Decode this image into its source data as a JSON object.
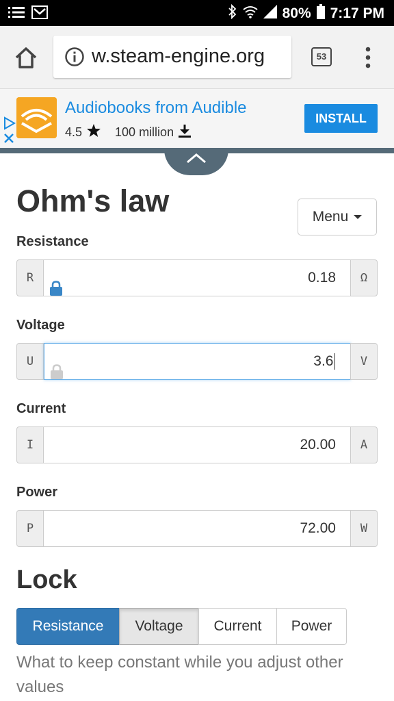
{
  "status_bar": {
    "battery": "80%",
    "time": "7:17 PM"
  },
  "browser": {
    "url": "w.steam-engine.org",
    "tab_count": "53"
  },
  "ad": {
    "title": "Audiobooks from Audible",
    "rating": "4.5",
    "downloads": "100 million",
    "install_label": "INSTALL"
  },
  "page": {
    "title": "Ohm's law",
    "menu_label": "Menu"
  },
  "fields": [
    {
      "label": "Resistance",
      "symbol": "R",
      "value": "0.18",
      "unit": "Ω",
      "locked": true
    },
    {
      "label": "Voltage",
      "symbol": "U",
      "value": "3.6",
      "unit": "V",
      "locked": false
    },
    {
      "label": "Current",
      "symbol": "I",
      "value": "20.00",
      "unit": "A"
    },
    {
      "label": "Power",
      "symbol": "P",
      "value": "72.00",
      "unit": "W"
    }
  ],
  "lock": {
    "title": "Lock",
    "options": [
      "Resistance",
      "Voltage",
      "Current",
      "Power"
    ],
    "selected": "Resistance",
    "help": "What to keep constant while you adjust other values"
  },
  "colors": {
    "primary": "#337ab7",
    "ad_blue": "#1a8be0",
    "lock_active": "#3a87c7",
    "lock_inactive": "#cccccc"
  },
  "icons": [
    "menu-list-icon",
    "mail-icon",
    "bluetooth-icon",
    "wifi-icon",
    "signal-icon",
    "battery-icon",
    "home-icon",
    "info-icon",
    "more-vert-icon",
    "ad-choices-icon",
    "close-icon",
    "audible-logo",
    "star-icon",
    "download-icon",
    "chevron-up-icon",
    "caret-down-icon",
    "lock-icon"
  ]
}
